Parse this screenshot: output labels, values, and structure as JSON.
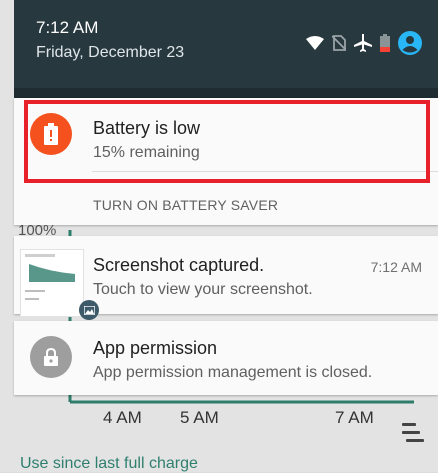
{
  "status_bar": {
    "time": "7:12 AM",
    "date": "Friday, December 23",
    "icons": [
      "wifi-icon",
      "no-sim-icon",
      "airplane-icon",
      "battery-low-icon",
      "account-icon"
    ],
    "bg_color": "#27383f",
    "accent_color": "#29b6f6"
  },
  "notifications": [
    {
      "id": "battery",
      "icon": "battery-alert-icon",
      "icon_color": "#f4511e",
      "title": "Battery is low",
      "subtitle": "15% remaining",
      "action": "TURN ON BATTERY SAVER",
      "highlighted": true
    },
    {
      "id": "screenshot",
      "icon": "screenshot-thumbnail",
      "title": "Screenshot captured.",
      "time": "7:12 AM",
      "subtitle": "Touch to view your screenshot."
    },
    {
      "id": "permission",
      "icon": "lock-icon",
      "icon_color": "#9e9e9e",
      "title": "App permission",
      "subtitle": "App permission management is closed."
    }
  ],
  "background": {
    "percent_label": "100%",
    "time_labels": [
      "4 AM",
      "5 AM",
      "7 AM"
    ],
    "footer": "Use since last full charge",
    "graph_color": "#2e7d6b"
  }
}
